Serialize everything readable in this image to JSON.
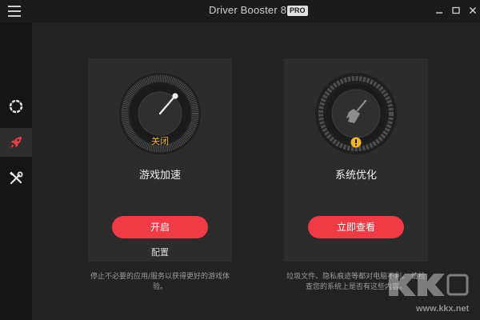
{
  "window": {
    "title": "Driver Booster 8.4",
    "badge": "PRO"
  },
  "sidebar": {
    "items": [
      {
        "icon": "circle-dots-icon"
      },
      {
        "icon": "rocket-icon",
        "active": true
      },
      {
        "icon": "tools-icon"
      }
    ]
  },
  "game_boost": {
    "gauge_status": "关闭",
    "title": "游戏加速",
    "button_label": "开启",
    "config_label": "配置",
    "description_line1": "停止不必要的应用/服务以获得更好的游戏体",
    "description_line2": "验。"
  },
  "system_optimize": {
    "title": "系统优化",
    "button_label": "立即查看",
    "description_line1": "垃圾文件、隐私痕迹等都对电脑不利。 请检",
    "description_line2": "查您的系统上是否有这些内容。"
  },
  "watermark": {
    "text": "www.kkx.net"
  },
  "colors": {
    "accent": "#ee3b45",
    "status_text": "#f0b52e",
    "warning": "#f0b52e"
  }
}
